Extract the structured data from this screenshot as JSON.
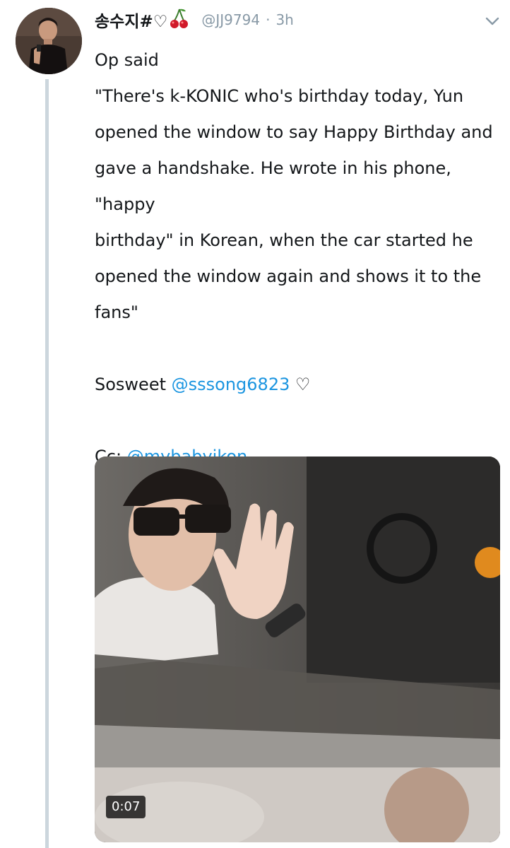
{
  "tweet": {
    "display_name": "송수지#♡",
    "handle": "@JJ9794",
    "separator": "·",
    "time": "3h",
    "body_lines": [
      "Op said",
      "\"There's k-KONIC who's birthday today, Yun",
      "opened the window to say Happy Birthday and",
      "gave a handshake. He wrote in his phone, \"happy",
      "birthday\" in Korean, when the car started he",
      "opened the window again and shows it to the",
      "fans\""
    ],
    "sweet_prefix": "Sosweet",
    "sweet_mention": "@sssong6823",
    "sweet_heart": "♡",
    "cc_prefix": "Cc:",
    "cc_mention": "@mybabyikon",
    "video_duration": "0:07"
  },
  "colors": {
    "mention": "#1b95e0",
    "muted": "#8899a6",
    "thread_line": "#ccd6dd"
  },
  "icons": {
    "header": "cherry-icon",
    "menu": "chevron-down-icon",
    "heart": "heart-outline"
  }
}
